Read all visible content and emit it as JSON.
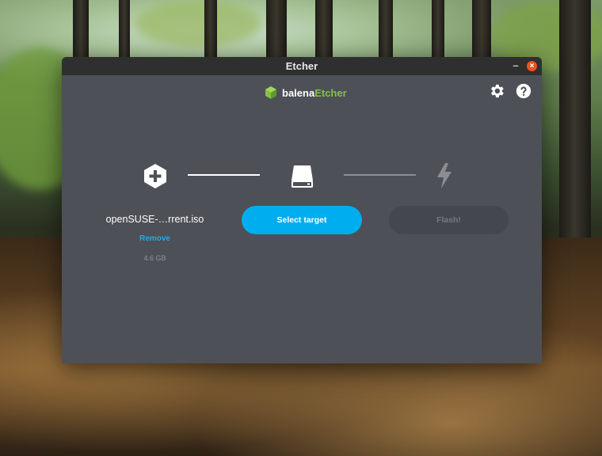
{
  "window": {
    "title": "Etcher",
    "minimize_symbol": "–",
    "close_symbol": "×"
  },
  "header": {
    "logo_text_1": "balena",
    "logo_text_2": "Etcher",
    "logo_icon": "cube-icon",
    "settings_icon": "gear-icon",
    "help_icon": "help-icon"
  },
  "steps": {
    "image": {
      "icon": "plus-hexagon-icon",
      "file_name": "openSUSE-…rrent.iso",
      "remove_label": "Remove",
      "size": "4.6 GB"
    },
    "target": {
      "icon": "drive-icon",
      "button_label": "Select target"
    },
    "flash": {
      "icon": "lightning-icon",
      "button_label": "Flash!"
    }
  },
  "colors": {
    "accent": "#00aeef",
    "link": "#2aa7e2",
    "brand_green": "#85c241",
    "window_bg": "#4d5057",
    "titlebar_bg": "#2f2f2f",
    "close_button": "#e95420",
    "disabled_button": "#44474d"
  }
}
